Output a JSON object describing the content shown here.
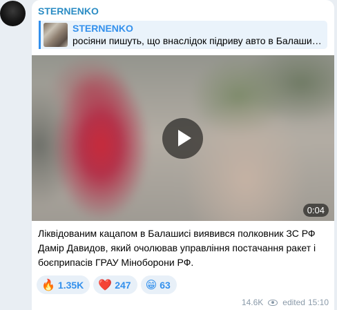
{
  "channel": {
    "name": "STERNENKO"
  },
  "reply": {
    "title": "STERNENKO",
    "text": "росіяни пишуть, що внаслідок підриву авто в Балаши…"
  },
  "video": {
    "duration": "0:04"
  },
  "message": {
    "text": "Ліквідованим кацапом в Балашисі виявився полковник ЗС РФ Дамір Давидов, який очолював управління постачання ракет і боєприпасів ГРАУ Міноборони РФ."
  },
  "reactions": [
    {
      "emoji": "🔥",
      "count": "1.35K"
    },
    {
      "emoji": "❤️",
      "count": "247"
    },
    {
      "emoji": "😁",
      "count": "63"
    }
  ],
  "meta": {
    "views": "14.6K",
    "edited": "edited",
    "time": "15:10"
  }
}
